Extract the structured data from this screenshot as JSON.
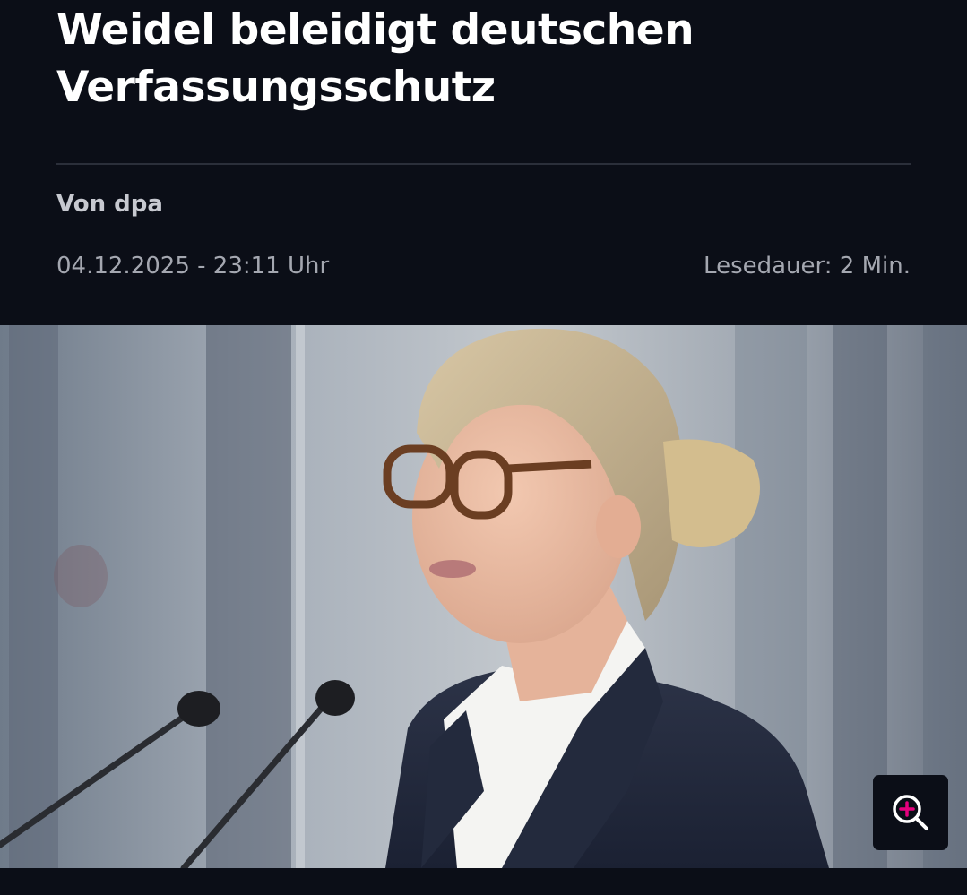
{
  "article": {
    "headline": "Weidel beleidigt deutschen Verfassungsschutz",
    "byline": "Von dpa",
    "date": "04.12.2025 - 23:11 Uhr",
    "reading_time": "Lesedauer: 2 Min."
  },
  "image": {
    "zoom_icon": "zoom-in-icon",
    "accent_color": "#e6007e"
  },
  "colors": {
    "background": "#0b0e17",
    "headline": "#ffffff",
    "meta": "#a4a7b0"
  }
}
